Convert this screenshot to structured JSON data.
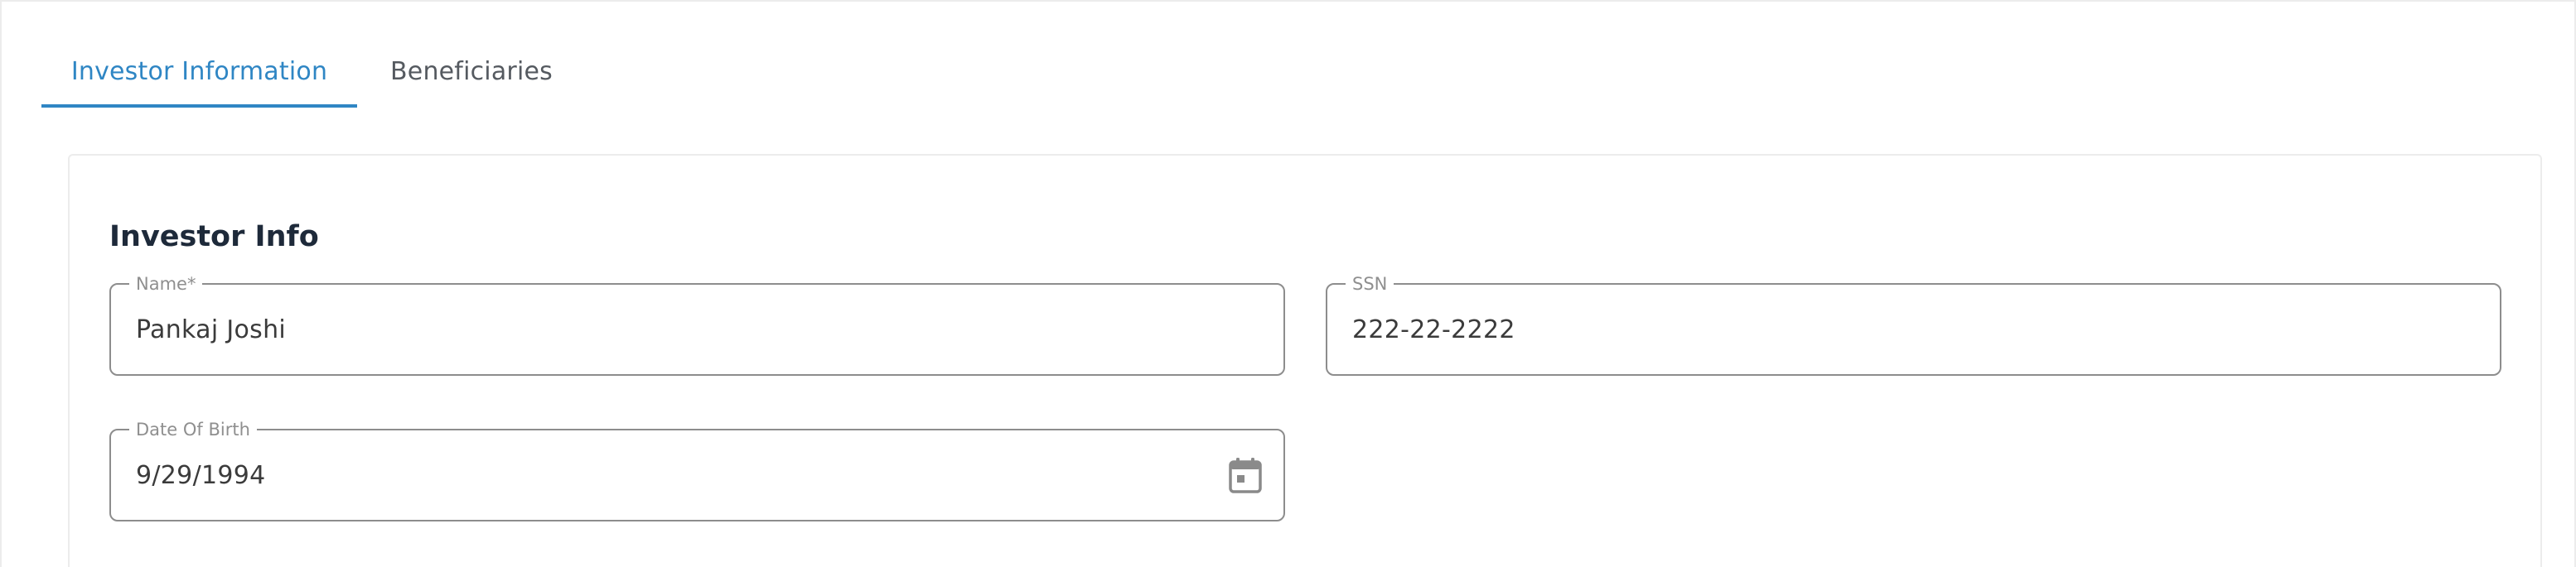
{
  "tabs": [
    {
      "label": "Investor Information",
      "active": true
    },
    {
      "label": "Beneficiaries",
      "active": false
    }
  ],
  "card": {
    "title": "Investor Info",
    "fields": {
      "name": {
        "label": "Name*",
        "value": "Pankaj Joshi"
      },
      "ssn": {
        "label": "SSN",
        "value": "222-22-2222"
      },
      "dob": {
        "label": "Date Of Birth",
        "value": "9/29/1994",
        "icon": "calendar-icon"
      }
    }
  },
  "colors": {
    "accent": "#2f86c4",
    "title": "#1e2a3a",
    "field_border": "#8d8d8d",
    "label": "#8f8f8f"
  }
}
